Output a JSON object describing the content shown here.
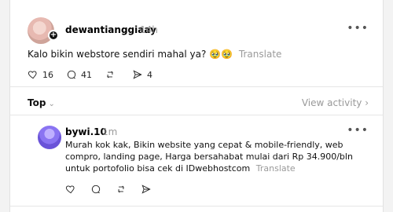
{
  "post": {
    "author": "dewantianggiaay",
    "time": "14h",
    "text": "Kalo bikin webstore sendiri mahal ya? 🥹🥹",
    "translate": "Translate",
    "actions": {
      "likes": "16",
      "comments": "41",
      "reposts": "",
      "shares": "4"
    }
  },
  "thread": {
    "sort": "Top",
    "view_activity": "View activity ›"
  },
  "reply": {
    "author": "bywi.10",
    "time": "1m",
    "text": "Murah kok kak, Bikin website yang cepat & mobile-friendly, web compro, landing page, Harga bersahabat mulai dari Rp 34.900/bln untuk portofolio bisa cek di IDwebhostcom",
    "translate": "Translate"
  }
}
